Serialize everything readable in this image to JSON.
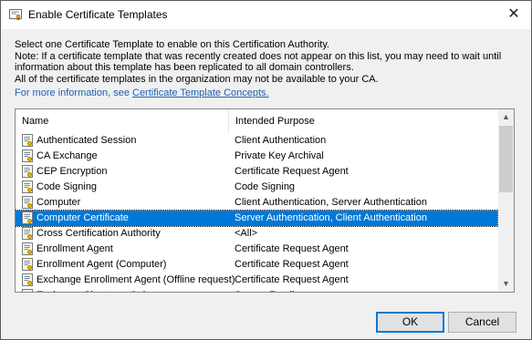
{
  "window": {
    "title": "Enable Certificate Templates",
    "close_glyph": "✕"
  },
  "instructions": {
    "lines": [
      "Select one Certificate Template to enable on this Certification Authority.",
      "Note: If a certificate template that was recently created does not appear on this list, you may need to wait until",
      "information about this template has been replicated to all domain controllers.",
      "All of the certificate templates in the organization may not be available to your CA."
    ],
    "more_info_prefix": "For more information, see ",
    "more_info_link": "Certificate Template Concepts."
  },
  "list": {
    "columns": [
      "Name",
      "Intended Purpose"
    ],
    "rows": [
      {
        "name": "Authenticated Session",
        "purpose": "Client Authentication",
        "selected": false
      },
      {
        "name": "CA Exchange",
        "purpose": "Private Key Archival",
        "selected": false
      },
      {
        "name": "CEP Encryption",
        "purpose": "Certificate Request Agent",
        "selected": false
      },
      {
        "name": "Code Signing",
        "purpose": "Code Signing",
        "selected": false
      },
      {
        "name": "Computer",
        "purpose": "Client Authentication, Server Authentication",
        "selected": false
      },
      {
        "name": "Computer Certificate",
        "purpose": "Server Authentication, Client Authentication",
        "selected": true
      },
      {
        "name": "Cross Certification Authority",
        "purpose": "<All>",
        "selected": false
      },
      {
        "name": "Enrollment Agent",
        "purpose": "Certificate Request Agent",
        "selected": false
      },
      {
        "name": "Enrollment Agent (Computer)",
        "purpose": "Certificate Request Agent",
        "selected": false
      },
      {
        "name": "Exchange Enrollment Agent (Offline request)",
        "purpose": "Certificate Request Agent",
        "selected": false
      },
      {
        "name": "Exchange Signature Only",
        "purpose": "Secure Email",
        "selected": false
      }
    ]
  },
  "buttons": {
    "ok": "OK",
    "cancel": "Cancel"
  },
  "icons": {
    "app": "certificate-icon",
    "row": "certificate-template-icon",
    "scroll_up": "▲",
    "scroll_down": "▼"
  },
  "colors": {
    "selection": "#0078d7",
    "link": "#1f5fb5"
  }
}
